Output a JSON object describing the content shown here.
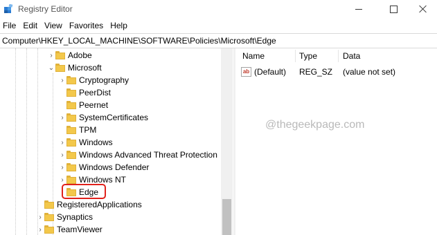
{
  "window": {
    "title": "Registry Editor"
  },
  "menu": [
    "File",
    "Edit",
    "View",
    "Favorites",
    "Help"
  ],
  "address": "Computer\\HKEY_LOCAL_MACHINE\\SOFTWARE\\Policies\\Microsoft\\Edge",
  "tree": {
    "adobe": "Adobe",
    "microsoft": "Microsoft",
    "children": [
      "Cryptography",
      "PeerDist",
      "Peernet",
      "SystemCertificates",
      "TPM",
      "Windows",
      "Windows Advanced Threat Protection",
      "Windows Defender",
      "Windows NT",
      "Edge"
    ],
    "registered": "RegisteredApplications",
    "synaptics": "Synaptics",
    "teamviewer": "TeamViewer"
  },
  "columns": {
    "name": "Name",
    "type": "Type",
    "data": "Data"
  },
  "values": [
    {
      "name": "(Default)",
      "type": "REG_SZ",
      "data": "(value not set)"
    }
  ],
  "watermark": "@thegeekpage.com",
  "colors": {
    "highlight": "#e0211b",
    "folder": "#f3c84b"
  }
}
